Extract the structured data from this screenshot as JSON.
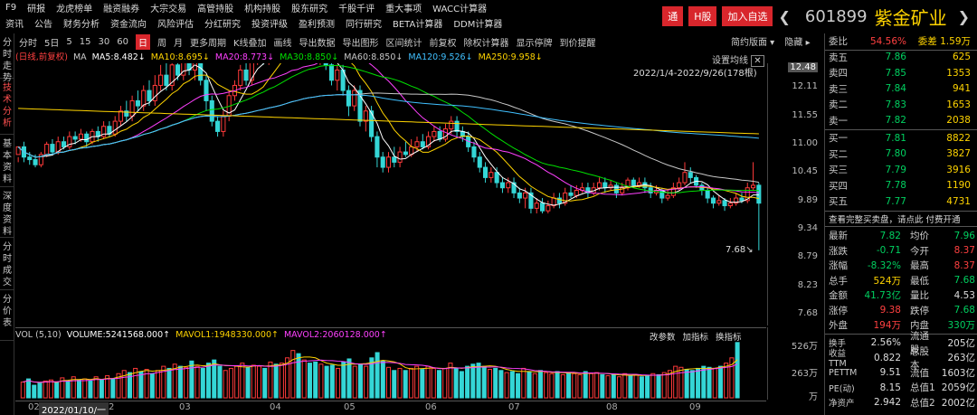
{
  "top_menu_row1": [
    "F9",
    "研报",
    "龙虎榜单",
    "融资融券",
    "大宗交易",
    "高管持股",
    "机构持股",
    "股东研究",
    "千股千评",
    "重大事项",
    "WACC计算器"
  ],
  "top_menu_row2": [
    "资讯",
    "公告",
    "财务分析",
    "资金流向",
    "风险评估",
    "分红研究",
    "投资评级",
    "盈利预测",
    "同行研究",
    "BETA计算器",
    "DDM计算器"
  ],
  "header": {
    "tong": "通",
    "hshare": "H股",
    "add_watch": "加入自选",
    "code": "601899",
    "name": "紫金矿业"
  },
  "left_tabs": [
    "分时走势",
    "技术分析",
    "基本资料",
    "深度资料",
    "分时成交",
    "分价表"
  ],
  "toolbar": {
    "items": [
      "分时",
      "5日",
      "5",
      "15",
      "30",
      "60",
      "日",
      "周",
      "月",
      "更多周期",
      "K线叠加",
      "画线",
      "导出数据",
      "导出图形",
      "区间统计",
      "前复权",
      "除权计算器",
      "显示停牌",
      "到价提醒"
    ],
    "selected": "日",
    "right1": "简约版面",
    "right2": "隐藏"
  },
  "ma_legend": {
    "prefix": "(日线,前复权)",
    "ma": "MA",
    "items": [
      {
        "text": "MA5:8.482↓",
        "color": "#ffffff"
      },
      {
        "text": "MA10:8.695↓",
        "color": "#ffd400"
      },
      {
        "text": "MA20:8.773↓",
        "color": "#ff40ff"
      },
      {
        "text": "MA30:8.850↓",
        "color": "#00e000"
      },
      {
        "text": "MA60:8.850↓",
        "color": "#c8c8c8"
      },
      {
        "text": "MA120:9.526↓",
        "color": "#40c0ff"
      },
      {
        "text": "MA250:9.958↓",
        "color": "#ffd400"
      }
    ]
  },
  "chart_info": {
    "set_ma": "设置均线",
    "range": "2022/1/4-2022/9/26(178根)",
    "high_label": "12.66",
    "low_label": "7.68"
  },
  "y_axis": [
    "12.48",
    "12.11",
    "11.55",
    "11.00",
    "10.45",
    "9.89",
    "9.34",
    "8.79",
    "8.23",
    "7.68"
  ],
  "vol_legend": {
    "prefix": "VOL (5,10)",
    "items": [
      {
        "text": "VOLUME:5241568.000↑",
        "color": "#ffffff"
      },
      {
        "text": "MAVOL1:1948330.000↑",
        "color": "#ffd400"
      },
      {
        "text": "MAVOL2:2060128.000↑",
        "color": "#ff40ff"
      }
    ]
  },
  "vol_tabs": [
    "改参数",
    "加指标",
    "换指标"
  ],
  "vol_y": [
    "526万",
    "263万",
    "万"
  ],
  "x_axis": {
    "first": "02",
    "cursor": "2022/01/10/一",
    "months": [
      "2",
      "03",
      "04",
      "05",
      "06",
      "07",
      "08",
      "09"
    ]
  },
  "order_book": {
    "asks": [
      {
        "label": "委比",
        "price": "54.56%",
        "vol": "委差 1.59万"
      },
      {
        "label": "卖五",
        "price": "7.86",
        "vol": "625"
      },
      {
        "label": "卖四",
        "price": "7.85",
        "vol": "1353"
      },
      {
        "label": "卖三",
        "price": "7.84",
        "vol": "941"
      },
      {
        "label": "卖二",
        "price": "7.83",
        "vol": "1653"
      },
      {
        "label": "卖一",
        "price": "7.82",
        "vol": "2038"
      }
    ],
    "bids": [
      {
        "label": "买一",
        "price": "7.81",
        "vol": "8822"
      },
      {
        "label": "买二",
        "price": "7.80",
        "vol": "3827"
      },
      {
        "label": "买三",
        "price": "7.79",
        "vol": "3916"
      },
      {
        "label": "买四",
        "price": "7.78",
        "vol": "1190"
      },
      {
        "label": "买五",
        "price": "7.77",
        "vol": "4731"
      }
    ],
    "full_l2": "查看完整买卖盘，请点此 付费开通"
  },
  "quote": [
    {
      "k": "最新",
      "v": "7.82",
      "vc": "green",
      "k2": "均价",
      "v2": "7.96",
      "v2c": "green"
    },
    {
      "k": "涨跌",
      "v": "-0.71",
      "vc": "green",
      "k2": "今开",
      "v2": "8.37",
      "v2c": "red"
    },
    {
      "k": "涨幅",
      "v": "-8.32%",
      "vc": "green",
      "k2": "最高",
      "v2": "8.37",
      "v2c": "red"
    },
    {
      "k": "总手",
      "v": "524万",
      "vc": "yellow",
      "k2": "最低",
      "v2": "7.68",
      "v2c": "green"
    },
    {
      "k": "金额",
      "v": "41.73亿",
      "vc": "green",
      "k2": "量比",
      "v2": "4.53",
      "v2c": "white"
    },
    {
      "k": "涨停",
      "v": "9.38",
      "vc": "red",
      "k2": "跌停",
      "v2": "7.68",
      "v2c": "green"
    },
    {
      "k": "外盘",
      "v": "194万",
      "vc": "red",
      "k2": "内盘",
      "v2": "330万",
      "v2c": "green"
    }
  ],
  "fundamentals": [
    {
      "k": "换手",
      "v": "2.56%",
      "k2": "流通股",
      "v2": "205亿"
    },
    {
      "k": "收益TTM",
      "v": "0.822",
      "k2": "总股本",
      "v2": "263亿"
    },
    {
      "k": "PETTM",
      "v": "9.51",
      "k2": "流值",
      "v2": "1603亿"
    },
    {
      "k": "PE(动)",
      "v": "8.15",
      "k2": "总值1",
      "v2": "2059亿"
    },
    {
      "k": "净资产",
      "v": "2.942",
      "k2": "总值2",
      "v2": "2002亿"
    }
  ],
  "candles": [
    [
      9.55,
      9.7,
      9.5,
      9.4
    ],
    [
      9.7,
      9.5,
      9.8,
      9.4
    ],
    [
      9.5,
      9.45,
      9.6,
      9.35
    ],
    [
      9.45,
      9.35,
      9.55,
      9.3
    ],
    [
      9.35,
      9.55,
      9.6,
      9.3
    ],
    [
      9.55,
      9.75,
      9.8,
      9.5
    ],
    [
      9.75,
      9.6,
      9.85,
      9.55
    ],
    [
      9.6,
      9.8,
      9.9,
      9.55
    ],
    [
      9.8,
      9.7,
      9.9,
      9.65
    ],
    [
      9.7,
      9.9,
      10.0,
      9.65
    ],
    [
      9.9,
      9.85,
      10.0,
      9.75
    ],
    [
      9.85,
      9.95,
      10.05,
      9.8
    ],
    [
      9.95,
      9.8,
      10.0,
      9.7
    ],
    [
      9.8,
      10.0,
      10.05,
      9.75
    ],
    [
      10.0,
      9.9,
      10.1,
      9.8
    ],
    [
      9.9,
      10.1,
      10.2,
      9.85
    ],
    [
      10.1,
      9.95,
      10.2,
      9.9
    ],
    [
      9.95,
      10.2,
      10.3,
      9.9
    ],
    [
      10.2,
      10.4,
      10.5,
      10.1
    ],
    [
      10.4,
      10.3,
      10.6,
      10.2
    ],
    [
      10.3,
      10.6,
      10.7,
      10.2
    ],
    [
      10.6,
      10.5,
      10.8,
      10.4
    ],
    [
      10.5,
      10.8,
      10.9,
      10.4
    ],
    [
      10.8,
      10.6,
      11.0,
      10.5
    ],
    [
      10.6,
      10.9,
      11.1,
      10.5
    ],
    [
      10.9,
      11.1,
      11.3,
      10.8
    ],
    [
      11.1,
      10.9,
      11.4,
      10.8
    ],
    [
      10.9,
      11.3,
      11.5,
      10.8
    ],
    [
      11.3,
      11.1,
      11.6,
      11.0
    ],
    [
      11.1,
      11.5,
      11.7,
      11.0
    ],
    [
      11.5,
      11.2,
      11.6,
      11.1
    ],
    [
      11.2,
      11.4,
      11.5,
      11.0
    ],
    [
      11.4,
      11.0,
      11.5,
      10.9
    ],
    [
      11.0,
      10.6,
      11.1,
      10.4
    ],
    [
      10.6,
      10.2,
      10.7,
      10.1
    ],
    [
      10.2,
      10.0,
      10.3,
      9.9
    ],
    [
      10.0,
      10.3,
      10.4,
      9.9
    ],
    [
      10.3,
      10.7,
      10.8,
      10.2
    ],
    [
      10.7,
      10.9,
      11.0,
      10.6
    ],
    [
      10.9,
      11.2,
      11.3,
      10.8
    ],
    [
      11.2,
      11.0,
      11.4,
      10.9
    ],
    [
      11.0,
      11.4,
      11.5,
      10.9
    ],
    [
      11.4,
      11.6,
      11.7,
      11.3
    ],
    [
      11.6,
      11.4,
      11.8,
      11.3
    ],
    [
      11.4,
      11.7,
      11.9,
      11.3
    ],
    [
      11.7,
      11.5,
      11.8,
      11.4
    ],
    [
      11.5,
      11.8,
      12.0,
      11.4
    ],
    [
      11.8,
      12.1,
      12.2,
      11.7
    ],
    [
      12.1,
      12.3,
      12.66,
      12.0
    ],
    [
      12.3,
      11.9,
      12.4,
      11.8
    ],
    [
      11.9,
      12.2,
      12.3,
      11.8
    ],
    [
      12.2,
      11.8,
      12.3,
      11.6
    ],
    [
      11.8,
      11.5,
      11.9,
      11.4
    ],
    [
      11.5,
      11.7,
      11.8,
      11.3
    ],
    [
      11.7,
      11.3,
      11.8,
      11.2
    ],
    [
      11.3,
      11.0,
      11.4,
      10.9
    ],
    [
      11.0,
      11.2,
      11.3,
      10.8
    ],
    [
      11.2,
      10.8,
      11.3,
      10.7
    ],
    [
      10.8,
      10.5,
      10.9,
      10.3
    ],
    [
      10.5,
      10.8,
      10.9,
      10.4
    ],
    [
      10.8,
      10.2,
      10.9,
      10.1
    ],
    [
      10.2,
      10.4,
      10.5,
      10.0
    ],
    [
      10.4,
      9.9,
      10.5,
      9.8
    ],
    [
      9.9,
      9.5,
      10.0,
      9.3
    ],
    [
      9.5,
      9.3,
      9.6,
      9.2
    ],
    [
      9.3,
      9.5,
      9.6,
      9.2
    ],
    [
      9.5,
      9.4,
      9.7,
      9.3
    ],
    [
      9.4,
      9.6,
      9.7,
      9.3
    ],
    [
      9.6,
      9.55,
      9.8,
      9.5
    ],
    [
      9.55,
      9.7,
      9.85,
      9.5
    ],
    [
      9.7,
      9.8,
      9.9,
      9.6
    ],
    [
      9.8,
      9.7,
      9.95,
      9.65
    ],
    [
      9.7,
      9.9,
      10.0,
      9.65
    ],
    [
      9.9,
      10.0,
      10.1,
      9.8
    ],
    [
      10.0,
      9.85,
      10.1,
      9.8
    ],
    [
      9.85,
      10.05,
      10.15,
      9.8
    ],
    [
      10.05,
      10.2,
      10.3,
      9.95
    ],
    [
      10.2,
      10.0,
      10.3,
      9.9
    ],
    [
      10.0,
      9.9,
      10.1,
      9.8
    ],
    [
      9.9,
      9.7,
      10.0,
      9.6
    ],
    [
      9.7,
      9.5,
      9.8,
      9.4
    ],
    [
      9.5,
      9.3,
      9.6,
      9.2
    ],
    [
      9.3,
      9.1,
      9.4,
      9.0
    ],
    [
      9.1,
      9.2,
      9.3,
      9.0
    ],
    [
      9.2,
      9.0,
      9.3,
      8.9
    ],
    [
      9.0,
      8.9,
      9.1,
      8.8
    ],
    [
      8.9,
      9.0,
      9.1,
      8.8
    ],
    [
      9.0,
      8.8,
      9.1,
      8.7
    ],
    [
      8.8,
      8.7,
      8.9,
      8.6
    ],
    [
      8.7,
      8.8,
      8.9,
      8.5
    ],
    [
      8.8,
      8.5,
      8.9,
      8.4
    ],
    [
      8.5,
      8.6,
      8.7,
      8.4
    ],
    [
      8.6,
      8.45,
      8.7,
      8.4
    ],
    [
      8.45,
      8.55,
      8.65,
      8.4
    ],
    [
      8.55,
      8.7,
      8.8,
      8.5
    ],
    [
      8.7,
      8.6,
      8.8,
      8.5
    ],
    [
      8.6,
      8.8,
      8.9,
      8.55
    ],
    [
      8.8,
      8.75,
      8.95,
      8.7
    ],
    [
      8.75,
      8.85,
      8.95,
      8.7
    ],
    [
      8.85,
      8.9,
      9.0,
      8.8
    ],
    [
      8.9,
      8.8,
      9.0,
      8.7
    ],
    [
      8.8,
      8.9,
      9.0,
      8.75
    ],
    [
      8.9,
      9.0,
      9.1,
      8.85
    ],
    [
      9.0,
      8.9,
      9.1,
      8.8
    ],
    [
      8.9,
      8.95,
      9.05,
      8.85
    ],
    [
      8.95,
      8.8,
      9.0,
      8.7
    ],
    [
      8.8,
      8.9,
      9.0,
      8.75
    ],
    [
      8.9,
      9.05,
      9.1,
      8.85
    ],
    [
      9.05,
      8.95,
      9.1,
      8.9
    ],
    [
      8.95,
      9.0,
      9.1,
      8.9
    ],
    [
      9.0,
      8.9,
      9.1,
      8.8
    ],
    [
      8.9,
      8.8,
      9.0,
      8.7
    ],
    [
      8.8,
      8.85,
      8.95,
      8.75
    ],
    [
      8.85,
      8.7,
      8.9,
      8.6
    ],
    [
      8.7,
      8.75,
      8.85,
      8.65
    ],
    [
      8.75,
      8.9,
      9.0,
      8.7
    ],
    [
      8.9,
      9.0,
      9.1,
      8.85
    ],
    [
      9.0,
      9.2,
      9.4,
      8.95
    ],
    [
      9.2,
      9.1,
      9.3,
      9.0
    ],
    [
      9.1,
      8.95,
      9.15,
      8.9
    ],
    [
      8.95,
      8.85,
      9.0,
      8.75
    ],
    [
      8.85,
      8.7,
      8.9,
      8.6
    ],
    [
      8.7,
      8.6,
      8.75,
      8.5
    ],
    [
      8.6,
      8.65,
      8.75,
      8.55
    ],
    [
      8.65,
      8.55,
      8.7,
      8.45
    ],
    [
      8.55,
      8.6,
      8.7,
      8.5
    ],
    [
      8.6,
      8.7,
      8.8,
      8.55
    ],
    [
      8.7,
      8.65,
      8.8,
      8.6
    ],
    [
      8.65,
      8.9,
      9.0,
      8.6
    ],
    [
      8.9,
      8.95,
      9.4,
      8.85
    ],
    [
      8.95,
      8.6,
      9.0,
      7.68
    ]
  ],
  "volumes": [
    150,
    180,
    120,
    140,
    160,
    170,
    150,
    190,
    160,
    200,
    170,
    180,
    160,
    200,
    170,
    210,
    180,
    230,
    260,
    240,
    280,
    250,
    270,
    230,
    260,
    300,
    280,
    320,
    300,
    290,
    350,
    300,
    280,
    330,
    360,
    300,
    260,
    280,
    300,
    330,
    290,
    310,
    300,
    280,
    340,
    320,
    330,
    380,
    450,
    420,
    360,
    330,
    340,
    320,
    300,
    310,
    280,
    340,
    370,
    300,
    320,
    300,
    380,
    430,
    350,
    290,
    260,
    280,
    260,
    280,
    300,
    270,
    300,
    280,
    260,
    280,
    330,
    280,
    250,
    300,
    320,
    330,
    300,
    270,
    280,
    260,
    240,
    250,
    230,
    280,
    250,
    230,
    260,
    240,
    230,
    250,
    220,
    240,
    230,
    220,
    250,
    230,
    240,
    220,
    210,
    220,
    200,
    230,
    210,
    220,
    200,
    210,
    230,
    220,
    240,
    260,
    300,
    290,
    270,
    260,
    280,
    300,
    290,
    280,
    300,
    330,
    380,
    526
  ]
}
